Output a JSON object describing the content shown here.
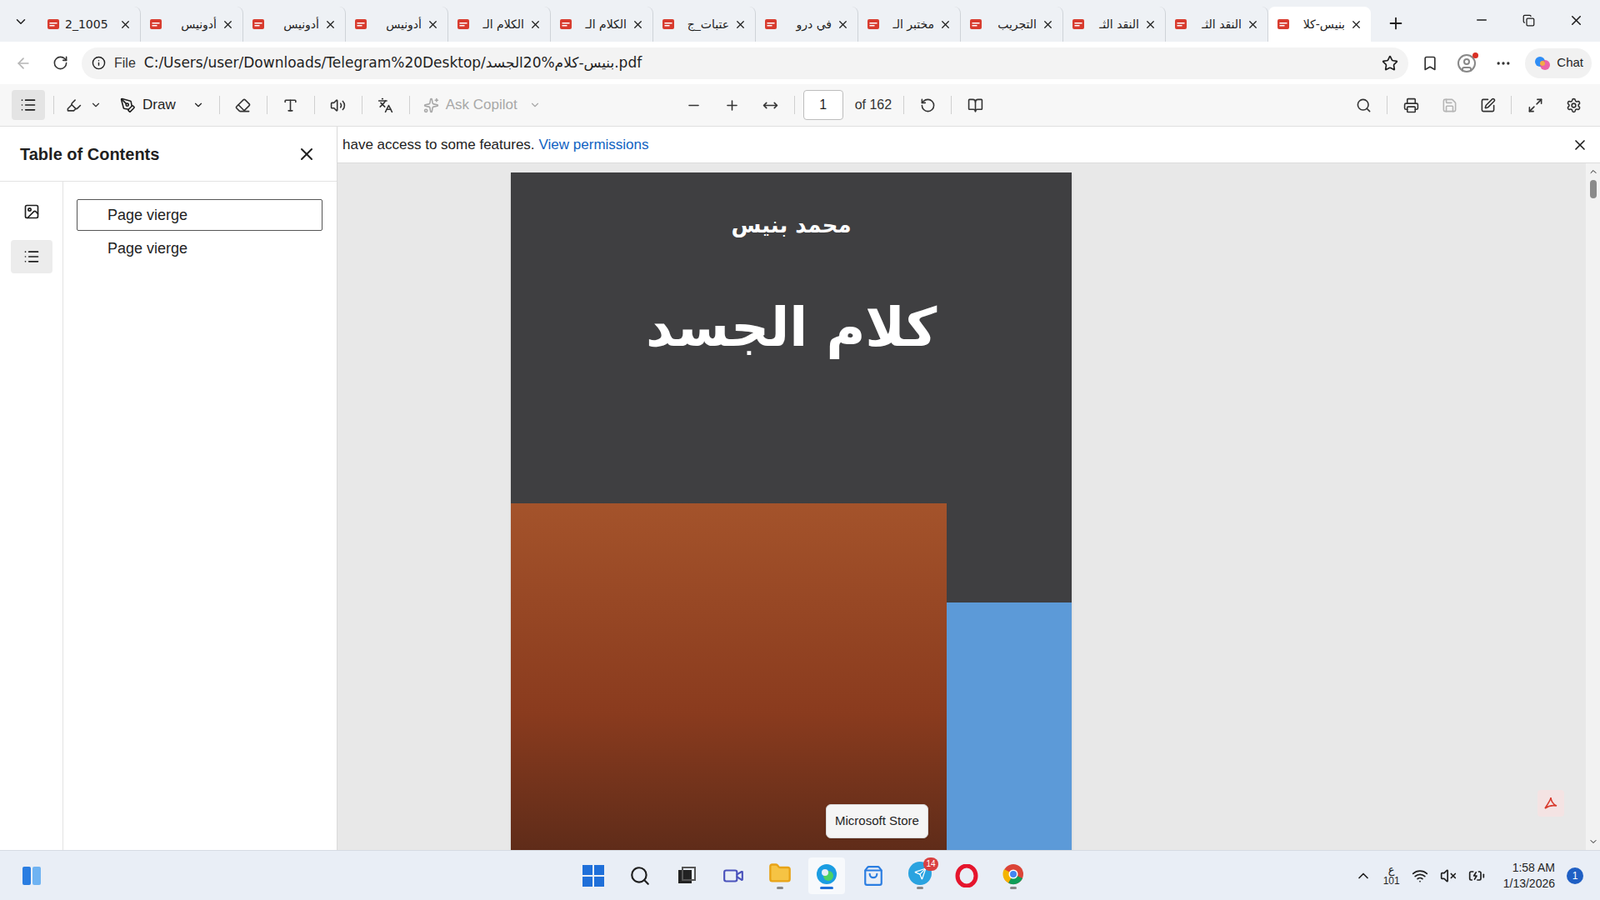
{
  "browser": {
    "tabs": [
      {
        "label": "2_1005",
        "selected": false
      },
      {
        "label": "أدونيس",
        "selected": false
      },
      {
        "label": "أدونيس",
        "selected": false
      },
      {
        "label": "أدونيس",
        "selected": false
      },
      {
        "label": "الكلام الـ",
        "selected": false
      },
      {
        "label": "الكلام الـ",
        "selected": false
      },
      {
        "label": "عتبات_ج",
        "selected": false
      },
      {
        "label": "في درو",
        "selected": false
      },
      {
        "label": "مختبر الـ",
        "selected": false
      },
      {
        "label": "التجريب",
        "selected": false
      },
      {
        "label": "النقد الثـ",
        "selected": false
      },
      {
        "label": "النقد الثـ",
        "selected": false
      },
      {
        "label": "بنيس-كلا",
        "selected": true
      }
    ],
    "address": {
      "prefix": "File",
      "url": "C:/Users/user/Downloads/Telegram%20Desktop/بنيس-كلام%20الجسد.pdf"
    },
    "chat_button": "Chat"
  },
  "pdf_toolbar": {
    "draw": "Draw",
    "ask_copilot": {
      "label": "Ask Copilot",
      "disabled": true
    },
    "page": "1",
    "total": "of 162",
    "save_disabled": true
  },
  "sidebar": {
    "title": "Table of Contents",
    "items": [
      {
        "label": "Page vierge",
        "selected": true
      },
      {
        "label": "Page vierge",
        "selected": false
      }
    ]
  },
  "notice": {
    "text": "have access to some features.",
    "link": "View permissions"
  },
  "document": {
    "author": "محمد بنيس",
    "title": "كلام الجسد"
  },
  "tooltip": "Microsoft Store",
  "taskbar": {
    "telegram_badge": "14",
    "language": "ع",
    "language_sub": "101",
    "time": "1:58 AM",
    "date": "1/13/2026",
    "notifications": "1"
  }
}
